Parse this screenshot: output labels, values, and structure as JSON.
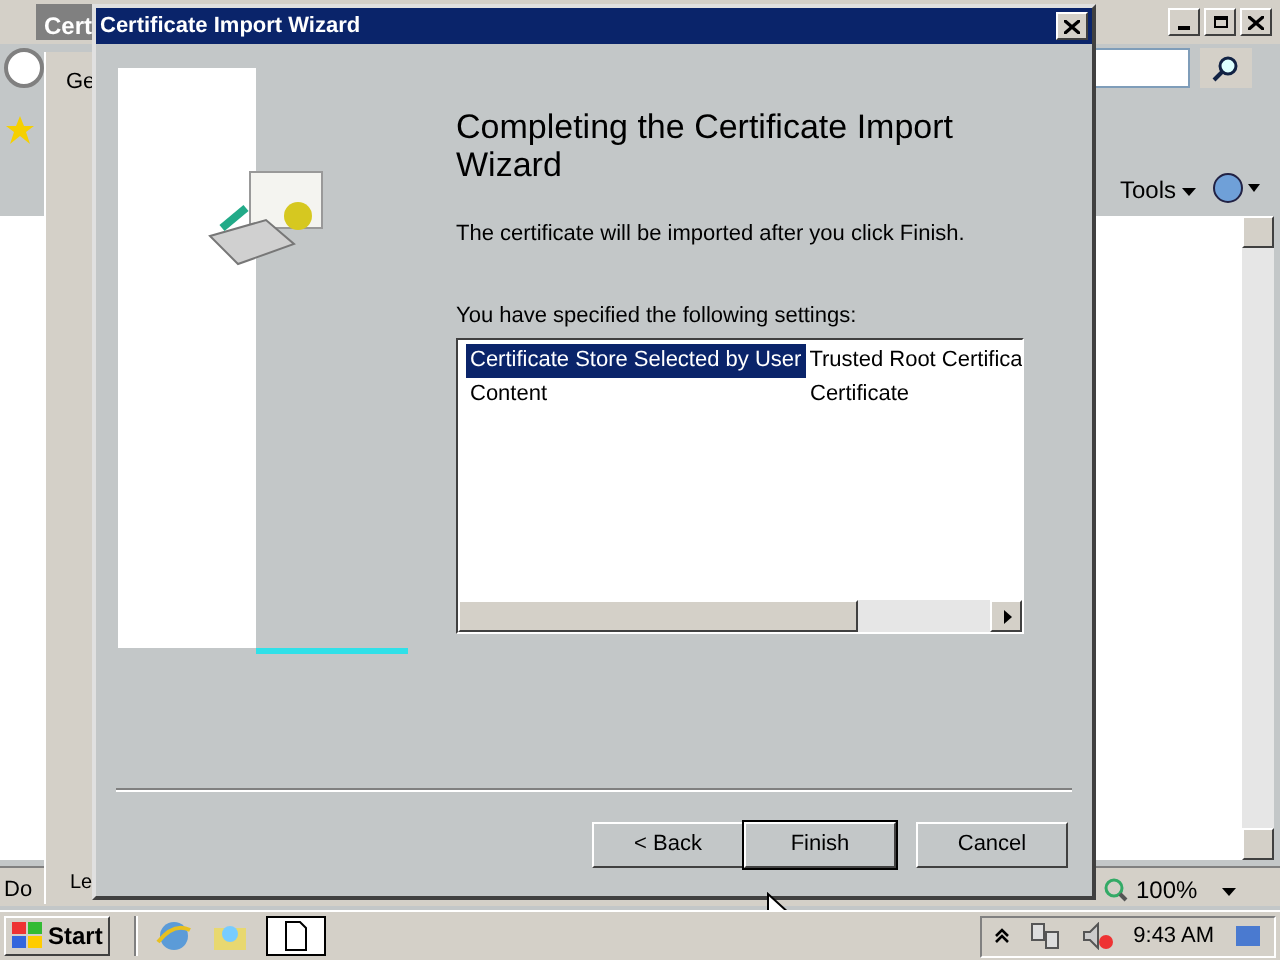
{
  "browser": {
    "window_title": "Cert",
    "tab": "Ge",
    "tools_menu": "Tools",
    "status_text": "Do",
    "zoom": "100%",
    "behind_text": "Le"
  },
  "dialog": {
    "title": "Certificate Import Wizard",
    "heading": "Completing the Certificate Import Wizard",
    "message": "The certificate will be imported after you click Finish.",
    "settings_label": "You have specified the following settings:",
    "settings": [
      {
        "name": "Certificate Store Selected by User",
        "value": "Trusted Root Certifica",
        "selected": true
      },
      {
        "name": "Content",
        "value": "Certificate",
        "selected": false
      }
    ],
    "buttons": [
      {
        "label": "< Back",
        "default": false
      },
      {
        "label": "Finish",
        "default": true
      },
      {
        "label": "Cancel",
        "default": false
      }
    ]
  },
  "taskbar": {
    "start": "Start",
    "clock": "9:43 AM"
  }
}
